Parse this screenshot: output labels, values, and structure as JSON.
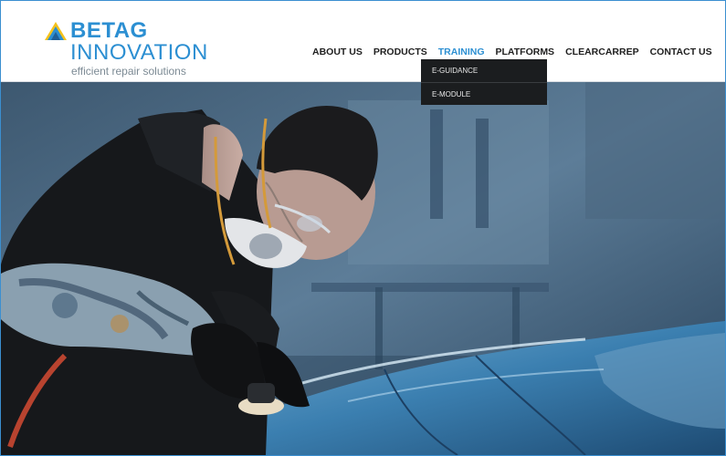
{
  "logo": {
    "line1": "BETAG",
    "line2": "INNOVATION",
    "tagline": "efficient repair solutions"
  },
  "nav": [
    {
      "label": "ABOUT US",
      "active": false
    },
    {
      "label": "PRODUCTS",
      "active": false
    },
    {
      "label": "TRAINING",
      "active": true
    },
    {
      "label": "PLATFORMS",
      "active": false
    },
    {
      "label": "CLEARCARREP",
      "active": false
    },
    {
      "label": "CONTACT US",
      "active": false
    }
  ],
  "training_dropdown": [
    "E-GUIDANCE",
    "E-MODULE"
  ],
  "colors": {
    "brand_blue": "#2c8fd2",
    "logo_yellow": "#f5c21b",
    "dropdown_bg": "#1b1d1f",
    "nav_text": "#1e1e1e"
  },
  "hero": {
    "image": "technician in black t-shirt, respirator mask and safety glasses polishing a blue car panel with a sanding tool"
  }
}
